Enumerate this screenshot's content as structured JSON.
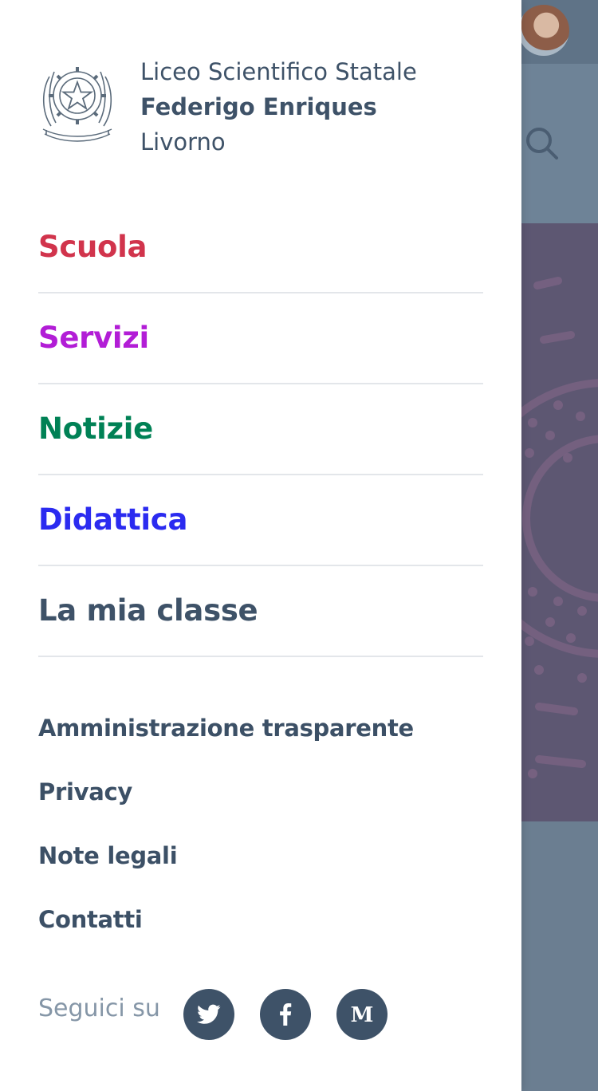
{
  "brand": {
    "line1": "Liceo Scientifico Statale",
    "line2": "Federigo Enriques",
    "line3": "Livorno",
    "emblem_icon": "repubblica-italiana-emblem-icon"
  },
  "main_nav": [
    {
      "label": "Scuola",
      "color": "#d1344c"
    },
    {
      "label": "Servizi",
      "color": "#b21dd6"
    },
    {
      "label": "Notizie",
      "color": "#008155"
    },
    {
      "label": "Didattica",
      "color": "#2b2bf0"
    },
    {
      "label": "La mia classe",
      "color": "#3e5268"
    }
  ],
  "secondary_nav": [
    {
      "label": "Amministrazione trasparente"
    },
    {
      "label": "Privacy"
    },
    {
      "label": "Note legali"
    },
    {
      "label": "Contatti"
    }
  ],
  "social": {
    "label": "Seguici su",
    "links": [
      {
        "icon": "twitter-icon"
      },
      {
        "icon": "facebook-icon"
      },
      {
        "icon": "medium-icon"
      }
    ]
  },
  "colors": {
    "text_primary": "#3e5268",
    "divider": "#e3e6ea",
    "social_button": "#3e5268",
    "overlay_hero": "#5d5772"
  }
}
